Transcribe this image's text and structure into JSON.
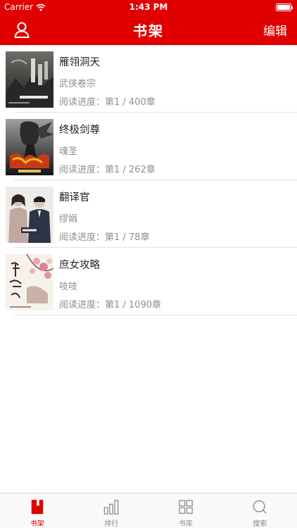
{
  "status_bar": {
    "carrier": "Carrier",
    "time": "1:43 PM"
  },
  "nav": {
    "title": "书架",
    "edit_label": "编辑"
  },
  "colors": {
    "brand": "#e00000",
    "secondary_text": "#8e8e8e",
    "separator": "#e3e3e3"
  },
  "books": [
    {
      "title": "雁翎洞天",
      "author": "武侠卷宗",
      "progress": "阅读进度：第1 / 400章",
      "cover": "dark-mountain-cover"
    },
    {
      "title": "终极剑尊",
      "author": "魂圣",
      "progress": "阅读进度：第1 / 262章",
      "cover": "sword-fire-cover"
    },
    {
      "title": "翻译官",
      "author": "缪娟",
      "progress": "阅读进度：第1 / 78章",
      "cover": "couple-cover"
    },
    {
      "title": "庶女攻略",
      "author": "吱吱",
      "progress": "阅读进度：第1 / 1090章",
      "cover": "blossom-cover"
    }
  ],
  "tabs": [
    {
      "label": "书架",
      "icon": "bookshelf-icon",
      "active": true
    },
    {
      "label": "排行",
      "icon": "ranking-bars-icon",
      "active": false
    },
    {
      "label": "书库",
      "icon": "library-grid-icon",
      "active": false
    },
    {
      "label": "搜索",
      "icon": "search-icon",
      "active": false
    }
  ]
}
